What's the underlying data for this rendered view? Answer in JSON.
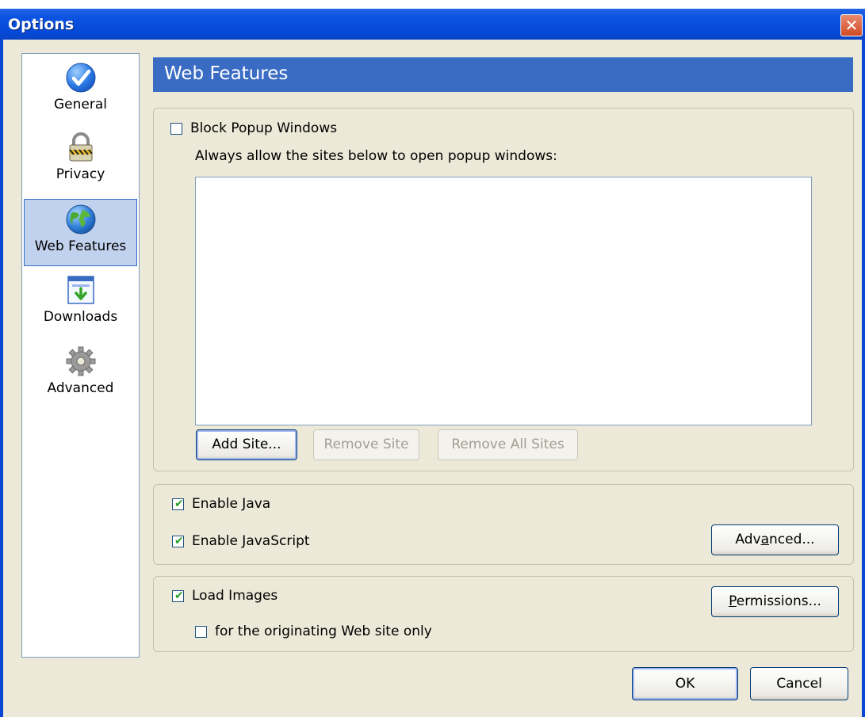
{
  "window": {
    "title": "Options",
    "close_glyph": "✕"
  },
  "sidebar": {
    "items": [
      {
        "label": "General",
        "icon": "checkmark-circle-icon",
        "selected": false
      },
      {
        "label": "Privacy",
        "icon": "padlock-icon",
        "selected": false
      },
      {
        "label": "Web Features",
        "icon": "globe-icon",
        "selected": true
      },
      {
        "label": "Downloads",
        "icon": "download-window-icon",
        "selected": false
      },
      {
        "label": "Advanced",
        "icon": "gear-icon",
        "selected": false
      }
    ]
  },
  "header": {
    "title": "Web Features"
  },
  "popup": {
    "block_label": "Block Popup Windows",
    "block_checked": false,
    "allow_text": "Always allow the sites below to open popup windows:",
    "sites": [],
    "add_site": "Add Site...",
    "remove_site": "Remove Site",
    "remove_all_sites": "Remove All Sites"
  },
  "java": {
    "enable_java": "Enable Java",
    "enable_java_checked": true,
    "enable_javascript": "Enable JavaScript",
    "enable_javascript_checked": true,
    "advanced_pre": "Adv",
    "advanced_accel": "a",
    "advanced_post": "nced..."
  },
  "images": {
    "load_images": "Load Images",
    "load_images_checked": true,
    "originating_only": "for the originating Web site only",
    "originating_only_checked": false,
    "permissions_accel": "P",
    "permissions_post": "ermissions..."
  },
  "footer": {
    "ok": "OK",
    "cancel": "Cancel"
  },
  "colors": {
    "header_bg": "#3a6cc3",
    "titlebar_blue": "#0649d8",
    "close_red": "#d04a25",
    "dialog_bg": "#ece9d8",
    "check_green": "#21a121"
  }
}
